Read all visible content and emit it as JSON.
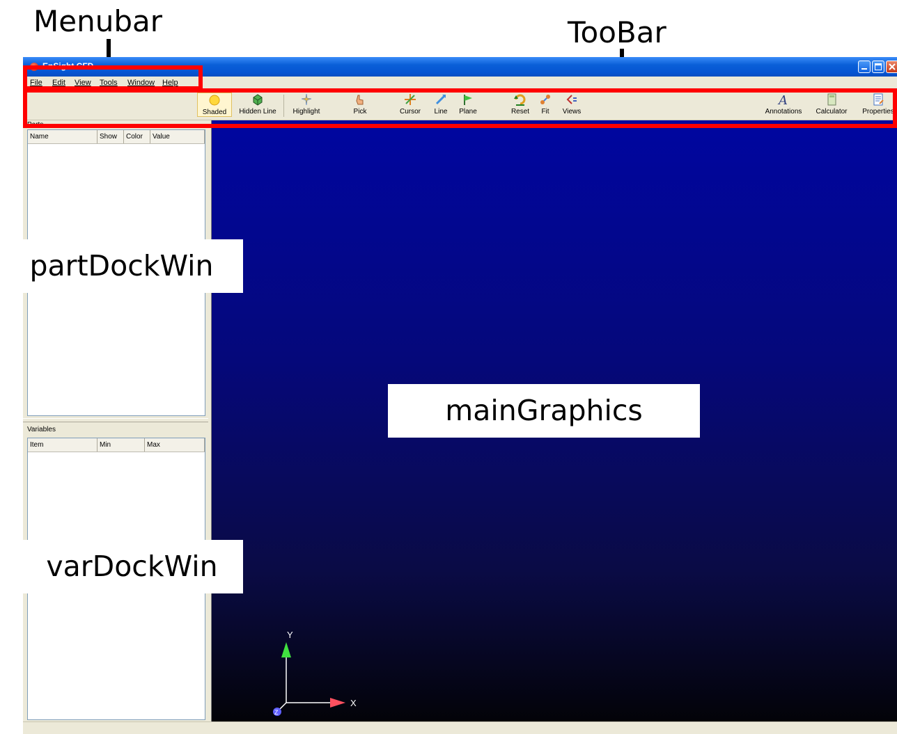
{
  "annotations": {
    "menubar_label": "Menubar",
    "toolbar_label": "TooBar",
    "part_dock_label": "partDockWin",
    "main_graphics_label": "mainGraphics",
    "var_dock_label": "varDockWin",
    "highlight_color": "#ff0000"
  },
  "window": {
    "title": "EnSight CFD",
    "minimize_icon": "minimize-icon",
    "maximize_icon": "maximize-icon",
    "close_icon": "close-icon"
  },
  "menubar": {
    "items": [
      "File",
      "Edit",
      "View",
      "Tools",
      "Window",
      "Help"
    ]
  },
  "toolbar": {
    "tools": [
      {
        "label": "Shaded",
        "icon": "sun-icon",
        "active": true
      },
      {
        "label": "Hidden Line",
        "icon": "cube-icon"
      },
      {
        "label": "Highlight",
        "icon": "sparkle-icon"
      },
      {
        "label": "Pick",
        "icon": "hand-icon"
      },
      {
        "label": "Cursor",
        "icon": "crosshair-icon"
      },
      {
        "label": "Line",
        "icon": "line-arrow-icon"
      },
      {
        "label": "Plane",
        "icon": "flag-icon"
      },
      {
        "label": "Reset",
        "icon": "reset-icon"
      },
      {
        "label": "Fit",
        "icon": "fit-icon"
      },
      {
        "label": "Views",
        "icon": "views-icon"
      },
      {
        "label": "Annotations",
        "icon": "annotation-a-icon"
      },
      {
        "label": "Calculator",
        "icon": "calculator-icon"
      },
      {
        "label": "Properties",
        "icon": "properties-icon"
      }
    ]
  },
  "parts_dock": {
    "title": "Parts",
    "columns": [
      "Name",
      "Show",
      "Color",
      "Value"
    ]
  },
  "variables_dock": {
    "title": "Variables",
    "columns": [
      "Item",
      "Min",
      "Max"
    ]
  },
  "graphics": {
    "axis_labels": {
      "y": "Y",
      "x": "X",
      "z": "Z"
    },
    "colors": {
      "top": "#0006a0",
      "bottom": "#030308",
      "y_axis": "#40e040",
      "x_axis": "#ff5060",
      "z_axis": "#6060ff"
    }
  }
}
